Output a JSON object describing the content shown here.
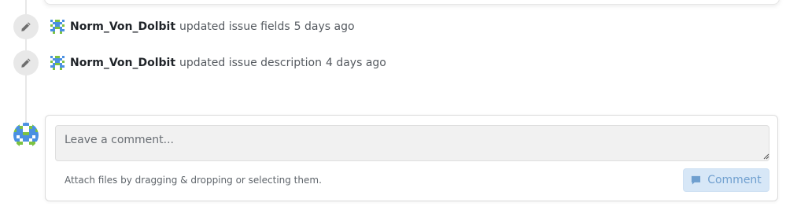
{
  "timeline": {
    "events": [
      {
        "user": "Norm_Von_Dolbit",
        "action": "updated issue fields",
        "time": "5 days ago",
        "icon": "pencil-icon"
      },
      {
        "user": "Norm_Von_Dolbit",
        "action": "updated issue description",
        "time": "4 days ago",
        "icon": "pencil-icon"
      }
    ]
  },
  "comment_form": {
    "placeholder": "Leave a comment...",
    "attach_hint": "Attach files by dragging & dropping or selecting them.",
    "submit_label": "Comment",
    "submit_icon": "speech-bubble-icon",
    "submit_enabled": false
  },
  "colors": {
    "timeline_gray": "#e8e8e8",
    "button_disabled_bg": "#d7e7f7",
    "button_disabled_text": "#6f9fcf",
    "avatar_blue": "#4a90e2",
    "avatar_green": "#7cc242"
  }
}
